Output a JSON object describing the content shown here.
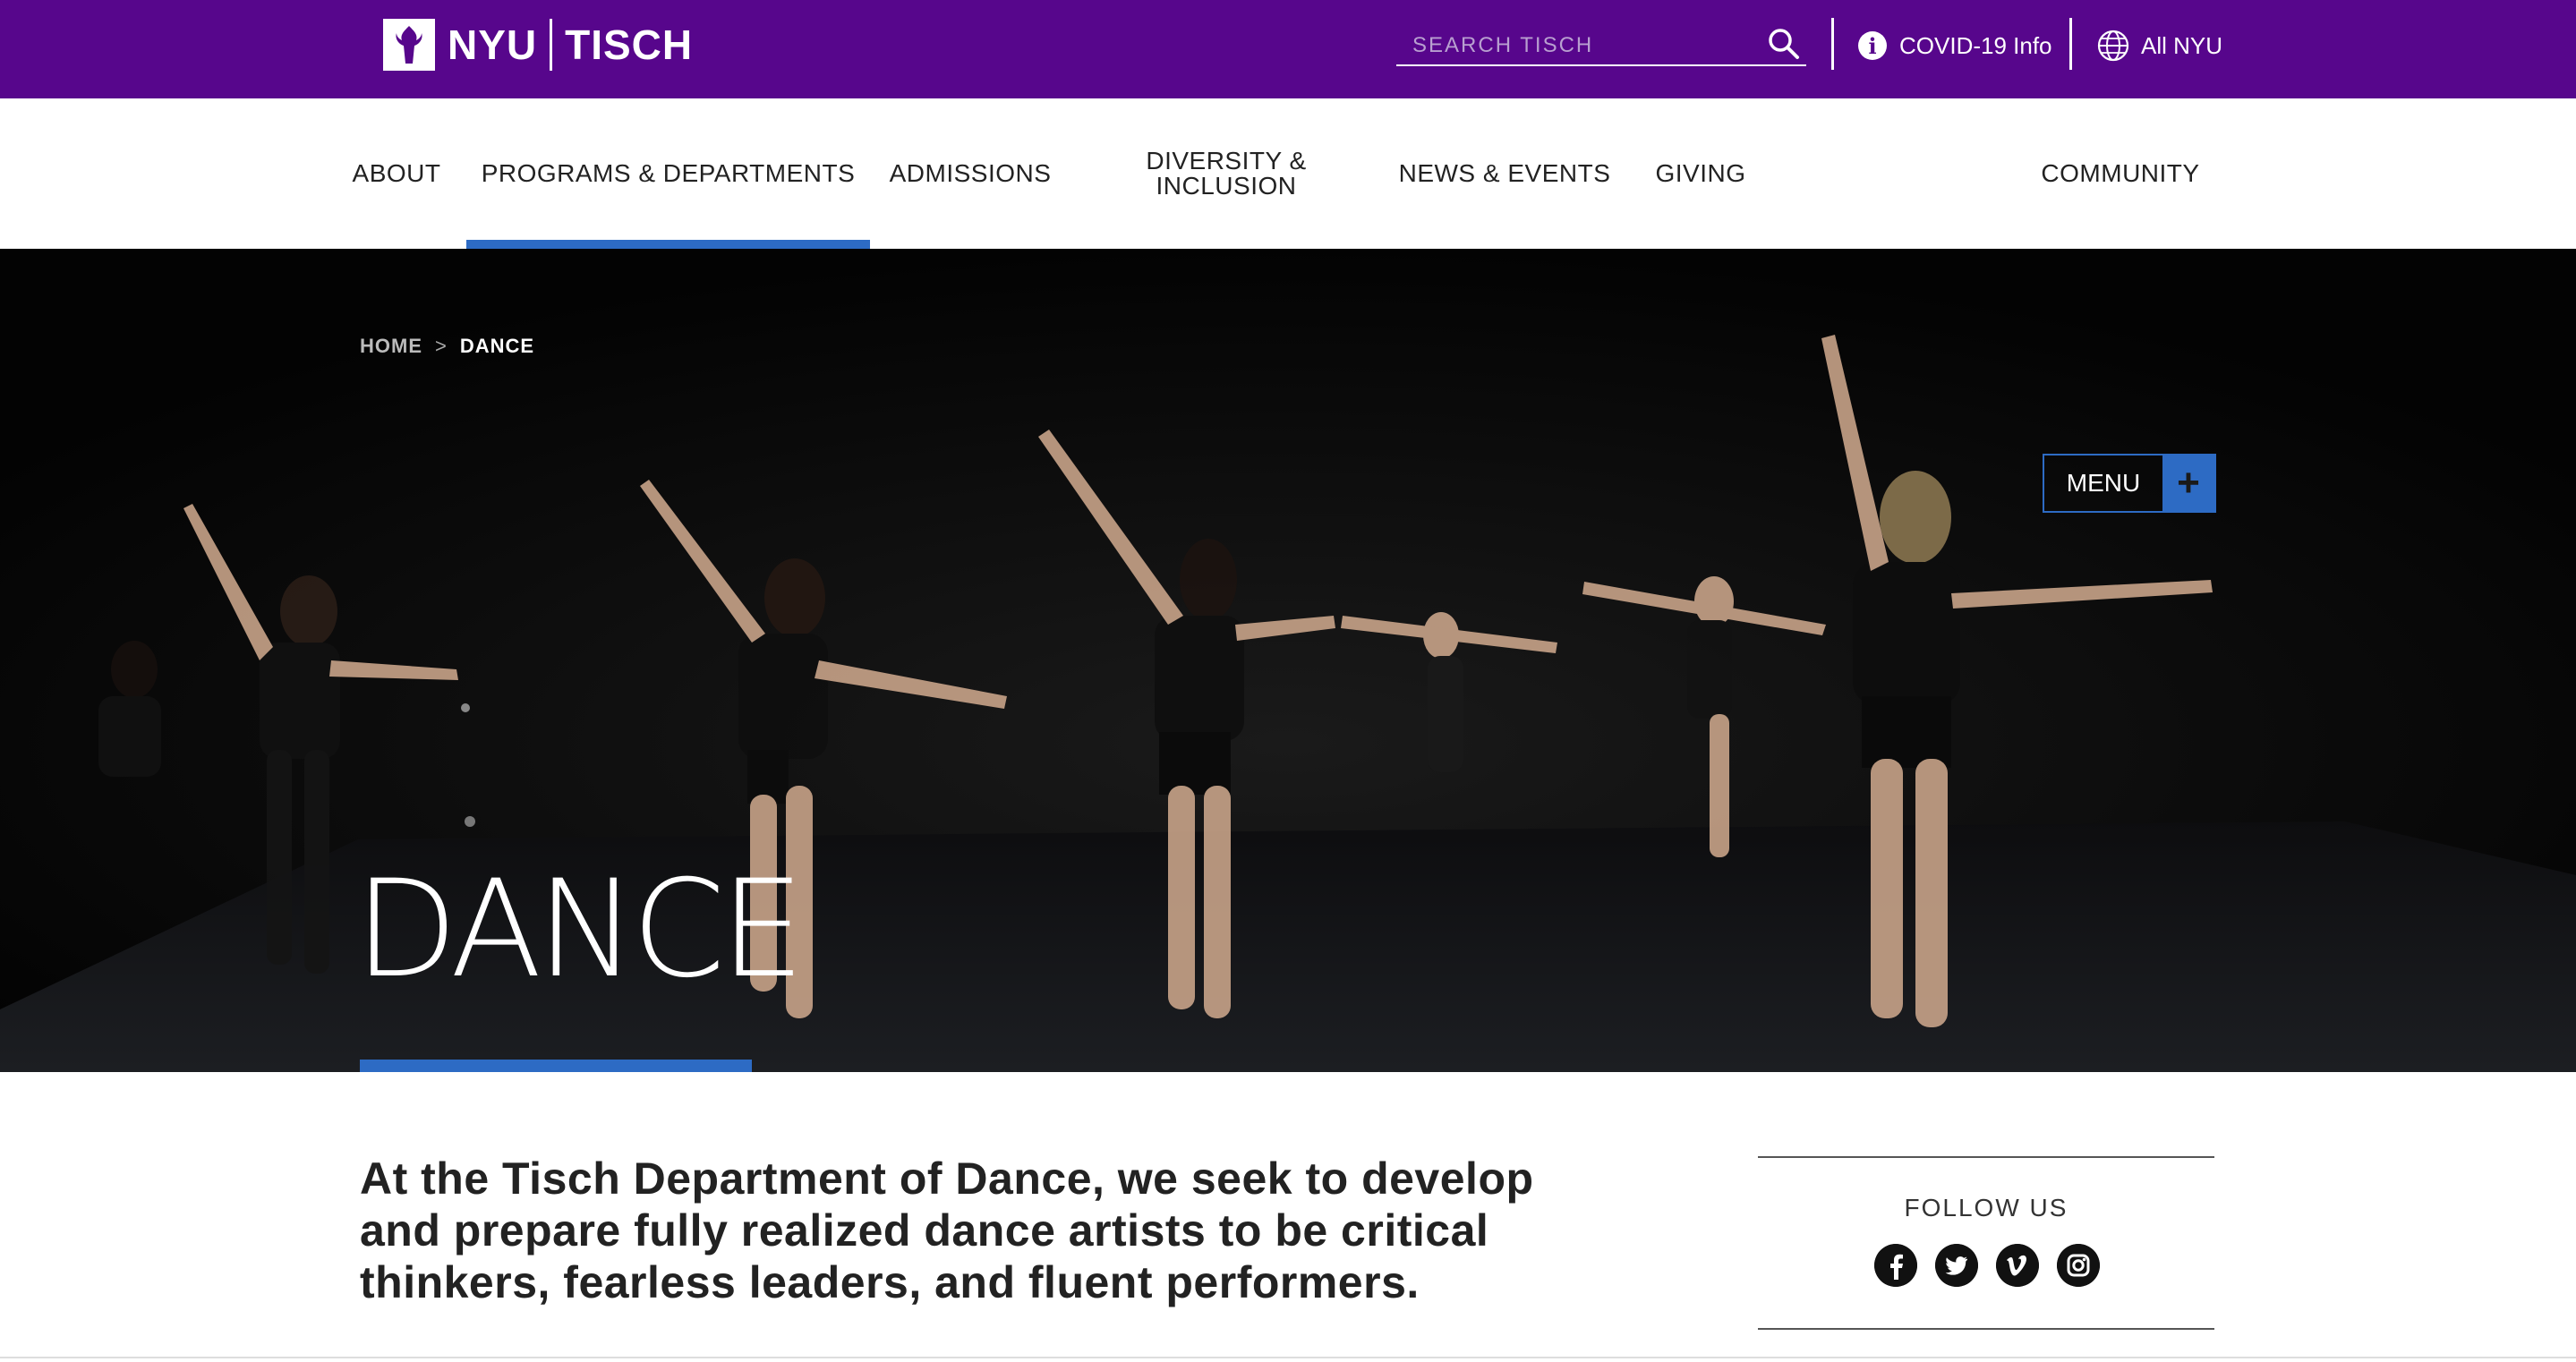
{
  "header": {
    "logo_left": "NYU",
    "logo_right": "TISCH",
    "search_placeholder": "SEARCH TISCH",
    "covid_label": "COVID-19 Info",
    "all_nyu_label": "All NYU"
  },
  "nav": {
    "items": [
      {
        "label": "ABOUT"
      },
      {
        "label": "PROGRAMS & DEPARTMENTS",
        "active": true
      },
      {
        "label": "ADMISSIONS"
      },
      {
        "label_line1": "DIVERSITY &",
        "label_line2": "INCLUSION"
      },
      {
        "label": "NEWS & EVENTS"
      },
      {
        "label": "GIVING"
      },
      {
        "label": "COMMUNITY"
      }
    ]
  },
  "hero": {
    "breadcrumb_home": "HOME",
    "breadcrumb_sep": ">",
    "breadcrumb_current": "DANCE",
    "menu_label": "MENU",
    "menu_icon": "+",
    "title": "DANCE"
  },
  "intro": {
    "line1": "At the Tisch Department of Dance, we seek to develop",
    "line2": "and prepare fully realized dance artists to be critical",
    "line3": "thinkers, fearless leaders, and fluent performers."
  },
  "follow": {
    "title": "FOLLOW US",
    "icons": [
      "facebook-icon",
      "twitter-icon",
      "vimeo-icon",
      "instagram-icon"
    ]
  },
  "colors": {
    "brand_purple": "#57068c",
    "accent_blue": "#2d6bc4",
    "hero_bg": "#050505"
  }
}
